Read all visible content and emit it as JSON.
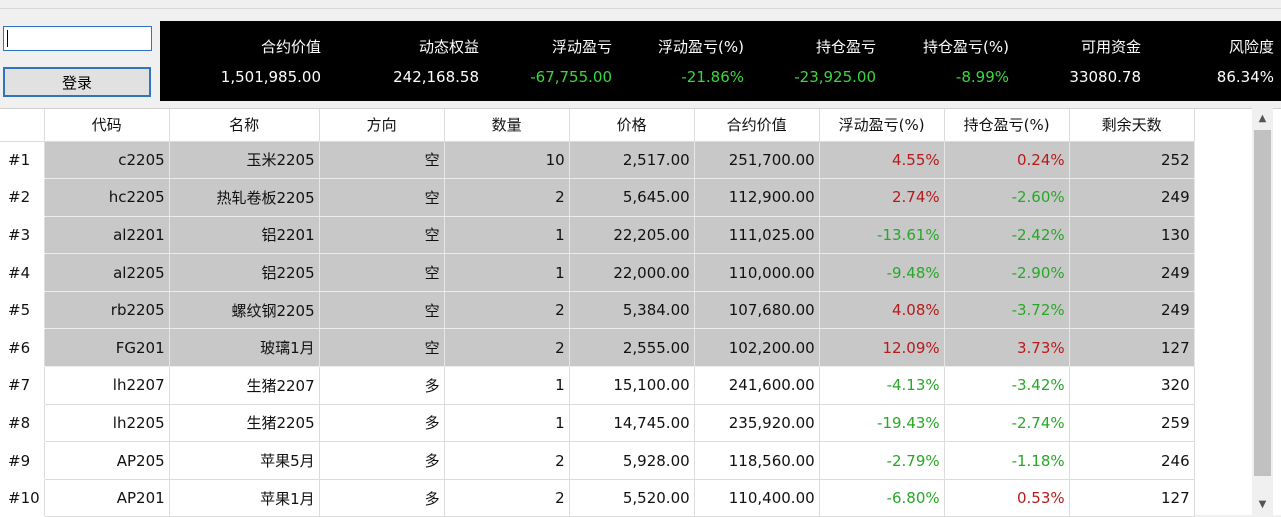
{
  "login": {
    "input_value": "",
    "button_label": "登录"
  },
  "summary": [
    {
      "label": "合约价值",
      "value": "1,501,985.00",
      "color": "white"
    },
    {
      "label": "动态权益",
      "value": "242,168.58",
      "color": "white"
    },
    {
      "label": "浮动盈亏",
      "value": "-67,755.00",
      "color": "green"
    },
    {
      "label": "浮动盈亏(%)",
      "value": "-21.86%",
      "color": "green"
    },
    {
      "label": "持仓盈亏",
      "value": "-23,925.00",
      "color": "green"
    },
    {
      "label": "持仓盈亏(%)",
      "value": "-8.99%",
      "color": "green"
    },
    {
      "label": "可用资金",
      "value": "33080.78",
      "color": "white"
    },
    {
      "label": "风险度",
      "value": "86.34%",
      "color": "white"
    }
  ],
  "table": {
    "headers": [
      "代码",
      "名称",
      "方向",
      "数量",
      "价格",
      "合约价值",
      "浮动盈亏(%)",
      "持仓盈亏(%)",
      "剩余天数"
    ],
    "rows": [
      {
        "index": "#1",
        "cells": [
          "c2205",
          "玉米2205",
          "空",
          "10",
          "2,517.00",
          "251,700.00",
          "4.55%",
          "0.24%",
          "252"
        ]
      },
      {
        "index": "#2",
        "cells": [
          "hc2205",
          "热轧卷板2205",
          "空",
          "2",
          "5,645.00",
          "112,900.00",
          "2.74%",
          "-2.60%",
          "249"
        ]
      },
      {
        "index": "#3",
        "cells": [
          "al2201",
          "铝2201",
          "空",
          "1",
          "22,205.00",
          "111,025.00",
          "-13.61%",
          "-2.42%",
          "130"
        ]
      },
      {
        "index": "#4",
        "cells": [
          "al2205",
          "铝2205",
          "空",
          "1",
          "22,000.00",
          "110,000.00",
          "-9.48%",
          "-2.90%",
          "249"
        ]
      },
      {
        "index": "#5",
        "cells": [
          "rb2205",
          "螺纹钢2205",
          "空",
          "2",
          "5,384.00",
          "107,680.00",
          "4.08%",
          "-3.72%",
          "249"
        ]
      },
      {
        "index": "#6",
        "cells": [
          "FG201",
          "玻璃1月",
          "空",
          "2",
          "2,555.00",
          "102,200.00",
          "12.09%",
          "3.73%",
          "127"
        ]
      },
      {
        "index": "#7",
        "cells": [
          "lh2207",
          "生猪2207",
          "多",
          "1",
          "15,100.00",
          "241,600.00",
          "-4.13%",
          "-3.42%",
          "320"
        ]
      },
      {
        "index": "#8",
        "cells": [
          "lh2205",
          "生猪2205",
          "多",
          "1",
          "14,745.00",
          "235,920.00",
          "-19.43%",
          "-2.74%",
          "259"
        ]
      },
      {
        "index": "#9",
        "cells": [
          "AP205",
          "苹果5月",
          "多",
          "2",
          "5,928.00",
          "118,560.00",
          "-2.79%",
          "-1.18%",
          "246"
        ]
      },
      {
        "index": "#10",
        "cells": [
          "AP201",
          "苹果1月",
          "多",
          "2",
          "5,520.00",
          "110,400.00",
          "-6.80%",
          "0.53%",
          "127"
        ]
      }
    ]
  },
  "colors": {
    "short_row_bg": "#c8c8c8",
    "negative": "#27a827",
    "positive": "#b51b1b",
    "summary_green": "#39d83c"
  },
  "scrollbar": {
    "up_icon": "scroll-up-arrow-icon",
    "down_icon": "scroll-down-arrow-icon"
  }
}
